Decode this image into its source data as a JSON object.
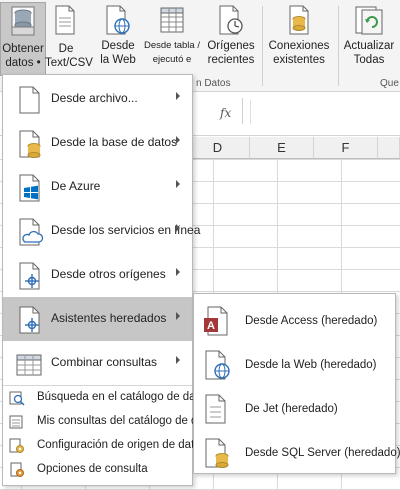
{
  "ribbon": {
    "buttons": [
      {
        "label": "Obtener\ndatos •",
        "icon": "database-icon",
        "active": true
      },
      {
        "label": "De\nText/CSV",
        "icon": "text-file-icon"
      },
      {
        "label": "Desde\nla Web",
        "icon": "web-page-icon"
      },
      {
        "label": "Desde tabla /\nejecutó e",
        "icon": "table-icon"
      },
      {
        "label": "Orígenes\nrecientes",
        "icon": "recent-sources-icon"
      },
      {
        "label": "Conexiones\nexistentes",
        "icon": "existing-connections-icon"
      },
      {
        "label": "Actualizar\nTodas",
        "icon": "refresh-icon"
      }
    ],
    "group_label_datos": "n Datos",
    "group_label_queries": "Que"
  },
  "formula_bar": {
    "fx": "fx"
  },
  "columns": [
    "D",
    "E",
    "F"
  ],
  "menu": {
    "items": [
      {
        "label": "Desde archivo...",
        "icon": "file-icon",
        "submenu": true
      },
      {
        "label": "Desde la base de datos",
        "icon": "database-file-icon",
        "submenu": true
      },
      {
        "label": "De Azure",
        "icon": "azure-file-icon",
        "submenu": true
      },
      {
        "label": "Desde los servicios en línea",
        "icon": "cloud-file-icon",
        "submenu": true
      },
      {
        "label": "Desde otros orígenes",
        "icon": "other-sources-file-icon",
        "submenu": true
      },
      {
        "label": "Asistentes heredados",
        "icon": "legacy-wizards-icon",
        "submenu": true,
        "highlighted": true
      },
      {
        "label": "Combinar consultas",
        "icon": "combine-queries-icon",
        "submenu": true
      }
    ],
    "small_items": [
      {
        "label": "Búsqueda en el catálogo de datos",
        "icon": "catalog-search-icon"
      },
      {
        "label": "Mis consultas del catálogo de datos",
        "icon": "catalog-queries-icon"
      },
      {
        "label": "Configuración de origen de datos",
        "icon": "data-source-settings-icon"
      },
      {
        "label": "Opciones de consulta",
        "icon": "query-options-icon"
      }
    ]
  },
  "submenu": {
    "items": [
      {
        "label": "Desde Access (heredado)",
        "icon": "access-icon"
      },
      {
        "label": "Desde la Web (heredado)",
        "icon": "web-legacy-icon"
      },
      {
        "label": "De Jet (heredado)",
        "icon": "jet-file-icon"
      },
      {
        "label": "Desde SQL Server (heredado)",
        "icon": "sql-server-icon"
      }
    ]
  },
  "colors": {
    "highlight": "#c6c6c6",
    "access_red": "#a4373a",
    "azure_blue": "#0072c6",
    "db_gold": "#e8b84a",
    "refresh_green": "#3a9a4a"
  }
}
